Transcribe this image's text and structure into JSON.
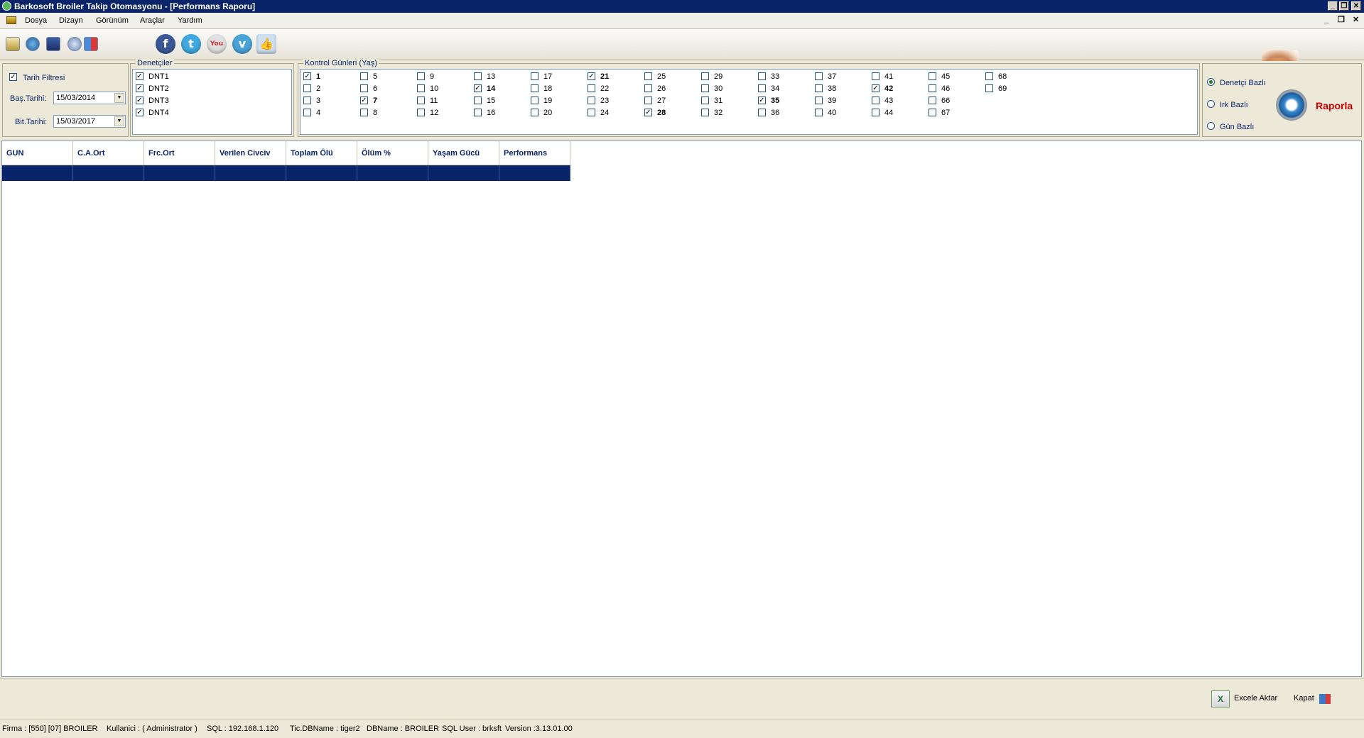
{
  "window": {
    "title": "Barkosoft Broiler Takip Otomasyonu - [Performans Raporu]"
  },
  "menu": {
    "items": [
      "Dosya",
      "Dizayn",
      "Görünüm",
      "Araçlar",
      "Yardım"
    ]
  },
  "toolbar": {
    "social": [
      "facebook-icon",
      "twitter-icon",
      "youtube-icon",
      "vimeo-icon",
      "like-icon"
    ]
  },
  "filters": {
    "date_filter_label": "Tarih Filtresi",
    "date_filter_checked": true,
    "start_label": "Baş.Tarihi:",
    "start_value": "15/03/2014",
    "end_label": "Bit.Tarihi:",
    "end_value": "15/03/2017"
  },
  "inspectors": {
    "legend": "Denetçiler",
    "items": [
      {
        "label": "DNT1",
        "checked": true
      },
      {
        "label": "DNT2",
        "checked": true
      },
      {
        "label": "DNT3",
        "checked": true
      },
      {
        "label": "DNT4",
        "checked": true
      }
    ]
  },
  "days": {
    "legend": "Kontrol Günleri (Yaş)",
    "columns": [
      [
        {
          "v": "1",
          "c": true
        },
        {
          "v": "2",
          "c": false
        },
        {
          "v": "3",
          "c": false
        },
        {
          "v": "4",
          "c": false
        }
      ],
      [
        {
          "v": "5",
          "c": false
        },
        {
          "v": "6",
          "c": false
        },
        {
          "v": "7",
          "c": true
        },
        {
          "v": "8",
          "c": false
        }
      ],
      [
        {
          "v": "9",
          "c": false
        },
        {
          "v": "10",
          "c": false
        },
        {
          "v": "11",
          "c": false
        },
        {
          "v": "12",
          "c": false
        }
      ],
      [
        {
          "v": "13",
          "c": false
        },
        {
          "v": "14",
          "c": true
        },
        {
          "v": "15",
          "c": false
        },
        {
          "v": "16",
          "c": false
        }
      ],
      [
        {
          "v": "17",
          "c": false
        },
        {
          "v": "18",
          "c": false
        },
        {
          "v": "19",
          "c": false
        },
        {
          "v": "20",
          "c": false
        }
      ],
      [
        {
          "v": "21",
          "c": true
        },
        {
          "v": "22",
          "c": false
        },
        {
          "v": "23",
          "c": false
        },
        {
          "v": "24",
          "c": false
        }
      ],
      [
        {
          "v": "25",
          "c": false
        },
        {
          "v": "26",
          "c": false
        },
        {
          "v": "27",
          "c": false
        },
        {
          "v": "28",
          "c": true
        }
      ],
      [
        {
          "v": "29",
          "c": false
        },
        {
          "v": "30",
          "c": false
        },
        {
          "v": "31",
          "c": false
        },
        {
          "v": "32",
          "c": false
        }
      ],
      [
        {
          "v": "33",
          "c": false
        },
        {
          "v": "34",
          "c": false
        },
        {
          "v": "35",
          "c": true
        },
        {
          "v": "36",
          "c": false
        }
      ],
      [
        {
          "v": "37",
          "c": false
        },
        {
          "v": "38",
          "c": false
        },
        {
          "v": "39",
          "c": false
        },
        {
          "v": "40",
          "c": false
        }
      ],
      [
        {
          "v": "41",
          "c": false
        },
        {
          "v": "42",
          "c": true
        },
        {
          "v": "43",
          "c": false
        },
        {
          "v": "44",
          "c": false
        }
      ],
      [
        {
          "v": "45",
          "c": false
        },
        {
          "v": "46",
          "c": false
        },
        {
          "v": "66",
          "c": false
        },
        {
          "v": "67",
          "c": false
        }
      ],
      [
        {
          "v": "68",
          "c": false
        },
        {
          "v": "69",
          "c": false
        }
      ]
    ]
  },
  "report_mode": {
    "options": [
      {
        "label": "Denetçi Bazlı",
        "selected": true
      },
      {
        "label": "Irk Bazlı",
        "selected": false
      },
      {
        "label": "Gün Bazlı",
        "selected": false
      }
    ],
    "button_label": "Raporla"
  },
  "table": {
    "columns": [
      "GUN",
      "C.A.Ort",
      "Frc.Ort",
      "Verilen Civciv",
      "Toplam Ölü",
      "Ölüm %",
      "Yaşam Gücü",
      "Performans"
    ]
  },
  "bottom": {
    "excel_label": "Excele Aktar",
    "close_label": "Kapat"
  },
  "status": {
    "firma": "Firma : [550] [07]  BROILER",
    "user": "Kullanici : ( Administrator )",
    "sql": "SQL : 192.168.1.120",
    "tic_db": "Tic.DBName : tiger2",
    "db": "DBName : BROILER",
    "sql_user": "SQL User : brksft",
    "version": "Version :3.13.01.00"
  },
  "colors": {
    "title_bar": "#0a246a",
    "selection": "#0a246a",
    "raporla": "#cc0000"
  }
}
